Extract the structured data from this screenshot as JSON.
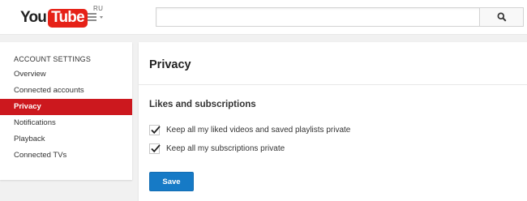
{
  "masthead": {
    "logo_you": "You",
    "logo_tube": "Tube",
    "logo_region": "RU",
    "guide_icon": "hamburger-menu-icon",
    "search": {
      "value": "",
      "placeholder": ""
    },
    "search_icon": "magnifier-icon"
  },
  "sidebar": {
    "heading": "ACCOUNT SETTINGS",
    "items": [
      {
        "label": "Overview",
        "active": false
      },
      {
        "label": "Connected accounts",
        "active": false
      },
      {
        "label": "Privacy",
        "active": true
      },
      {
        "label": "Notifications",
        "active": false
      },
      {
        "label": "Playback",
        "active": false
      },
      {
        "label": "Connected TVs",
        "active": false
      }
    ]
  },
  "main": {
    "title": "Privacy",
    "section_heading": "Likes and subscriptions",
    "options": [
      {
        "label": "Keep all my liked videos and saved playlists private",
        "checked": true
      },
      {
        "label": "Keep all my subscriptions private",
        "checked": true
      }
    ],
    "save_label": "Save"
  },
  "colors": {
    "brand_red": "#e62117",
    "active_nav": "#cc181e",
    "primary_button": "#167ac6",
    "checkmark": "#222222"
  }
}
